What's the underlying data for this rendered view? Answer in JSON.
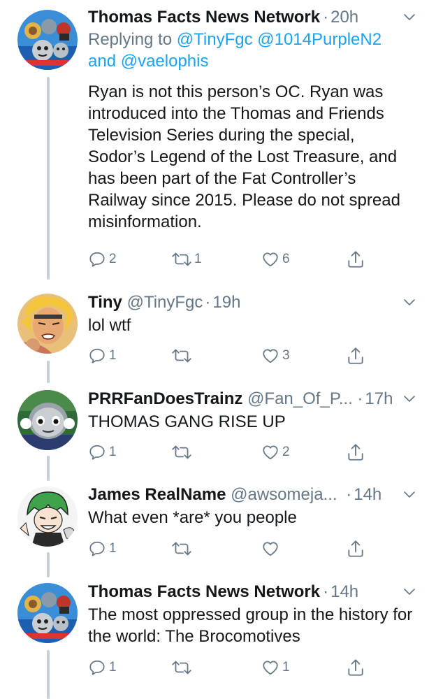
{
  "tweets": [
    {
      "name": "Thomas Facts News Network",
      "handle": "",
      "sep": "·",
      "time": "20h",
      "reply_prefix": "Replying to",
      "reply_m1": "@TinyFgc",
      "reply_m2": "@1014PurpleN2",
      "reply_and": "and",
      "reply_m3": "@vaelophis",
      "text": "Ryan is not this person’s OC. Ryan was introduced into the Thomas and Friends Television Series during the special, Sodor’s Legend of the Lost Treasure, and has been part of the Fat Controller’s Railway since 2015. Please do not spread misinformation.",
      "replies": "2",
      "retweets": "1",
      "likes": "6"
    },
    {
      "name": "Tiny",
      "handle": "@TinyFgc",
      "sep": "·",
      "time": "19h",
      "text": "lol wtf",
      "replies": "1",
      "retweets": "",
      "likes": "3"
    },
    {
      "name": "PRRFanDoesTrainz",
      "handle": "@Fan_Of_P...",
      "sep": "·",
      "time": "17h",
      "text": "THOMAS GANG RISE UP",
      "replies": "1",
      "retweets": "",
      "likes": "2"
    },
    {
      "name": "James RealName",
      "handle": "@awsomeja...",
      "sep": "·",
      "time": "14h",
      "text": "What even *are* you people",
      "replies": "1",
      "retweets": "",
      "likes": ""
    },
    {
      "name": "Thomas Facts News Network",
      "handle": "",
      "sep": "·",
      "time": "14h",
      "text": "The most oppressed group in the history for the world: The Brocomotives",
      "replies": "1",
      "retweets": "",
      "likes": "1"
    }
  ],
  "icons": {
    "reply": "reply-icon",
    "retweet": "retweet-icon",
    "like": "heart-icon",
    "share": "share-icon",
    "more": "chevron-down-icon"
  },
  "colors": {
    "name": "#14171a",
    "secondary": "#657786",
    "link": "#1da1f2",
    "thread_line": "#c4cfd6"
  }
}
